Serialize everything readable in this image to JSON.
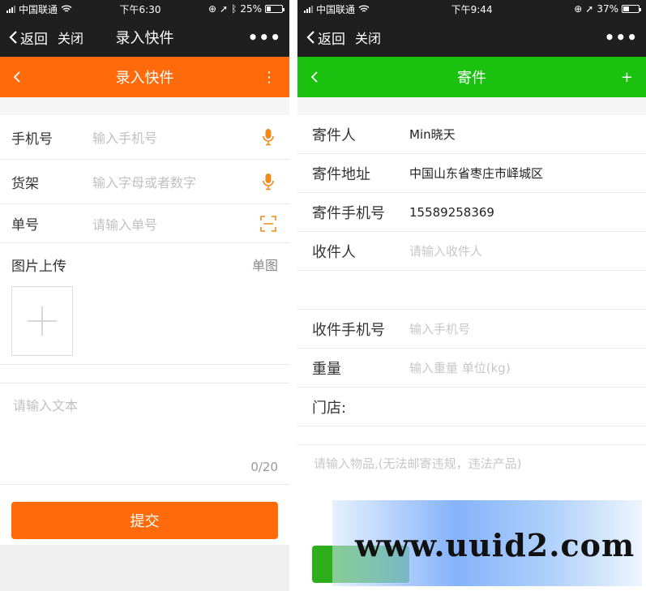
{
  "left": {
    "status": {
      "carrier": "中国联通",
      "time": "下午6:30",
      "battery": "25%",
      "battery_level": 0.25
    },
    "nav": {
      "back": "返回",
      "close": "关闭",
      "title": "录入快件",
      "more": "•••"
    },
    "header": {
      "title": "录入快件",
      "color": "#ff6b0b",
      "menu": "⋮"
    },
    "fields": [
      {
        "label": "手机号",
        "placeholder": "输入手机号",
        "icon": "microphone-icon"
      },
      {
        "label": "货架",
        "placeholder": "输入字母或者数字",
        "icon": "microphone-icon"
      },
      {
        "label": "单号",
        "placeholder": "请输入单号",
        "icon": "scan-icon"
      }
    ],
    "upload": {
      "label": "图片上传",
      "mode": "单图"
    },
    "text": {
      "placeholder": "请输入文本",
      "counter": "0/20"
    },
    "submit": "提交"
  },
  "right": {
    "status": {
      "carrier": "中国联通",
      "time": "下午9:44",
      "battery": "37%",
      "battery_level": 0.37
    },
    "nav": {
      "back": "返回",
      "close": "关闭",
      "more": "•••"
    },
    "header": {
      "title": "寄件",
      "color": "#1bc10f",
      "add": "+"
    },
    "sender": {
      "label": "寄件人",
      "value": "Min晓天"
    },
    "address": {
      "label": "寄件地址",
      "value": "中国山东省枣庄市峄城区"
    },
    "sender_phone": {
      "label": "寄件手机号",
      "value": "15589258369"
    },
    "receiver": {
      "label": "收件人",
      "placeholder": "请输入收件人"
    },
    "receiver_phone": {
      "label": "收件手机号",
      "placeholder": "输入手机号"
    },
    "weight": {
      "label": "重量",
      "placeholder": "输入重量 单位(kg)"
    },
    "store": {
      "label": "门店:"
    },
    "note": {
      "placeholder": "请输入物品,(无法邮寄违规，违法产品)"
    }
  },
  "watermark": "www.uuid2.com"
}
